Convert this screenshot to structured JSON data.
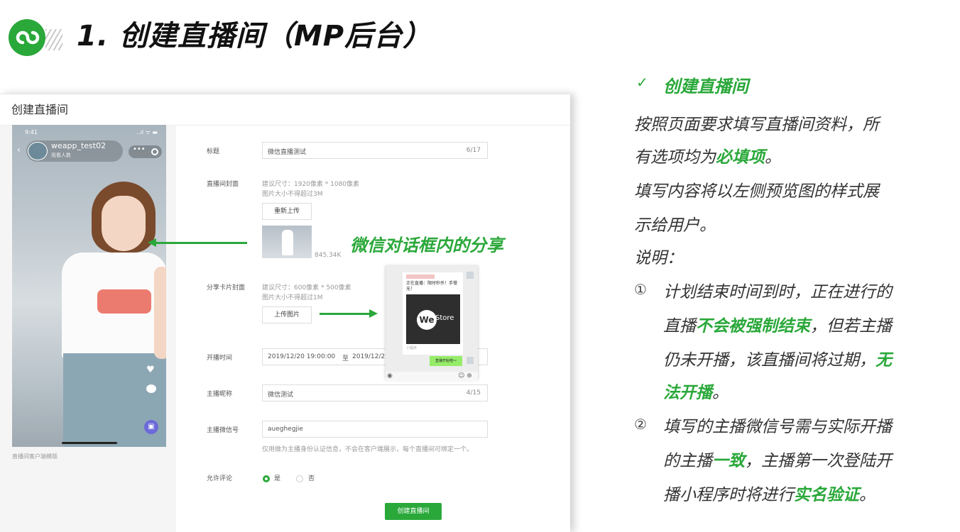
{
  "slide": {
    "title": "1. 创建直播间（MP后台）"
  },
  "colors": {
    "accent": "#2aa83a",
    "text": "#333333"
  },
  "screenshot": {
    "page_title": "创建直播间",
    "preview": {
      "time": "9:41",
      "signal": "..ıl ᯤ ▬",
      "room_name": "weapp_test02",
      "room_sub": "观看人数",
      "more_dots": "•••",
      "caption": "直播间客户端模版"
    },
    "form": {
      "title_label": "标题",
      "title_value": "微信直播测试",
      "title_count": "6/17",
      "cover_label": "直播间封面",
      "cover_hint_size": "建议尺寸：1920像素 * 1080像素",
      "cover_hint_limit": "图片大小不得超过3M",
      "reupload": "重新上传",
      "cover_file_size": "845.34K",
      "share_card_label": "分享卡片封面",
      "share_hint_size": "建议尺寸：600像素 * 500像素",
      "share_hint_limit": "图片大小不得超过1M",
      "upload_image": "上传图片",
      "time_label": "开播时间",
      "time_start": "2019/12/20 19:00:00",
      "time_sep": "至",
      "time_end": "2019/12/2",
      "anchor_nick_label": "主播昵称",
      "anchor_nick_value": "微信测试",
      "anchor_nick_count": "4/15",
      "anchor_wechat_label": "主播微信号",
      "anchor_wechat_value": "aueghegjie",
      "anchor_wechat_hint": "仅用做为主播身份认证信息，不会在客户端展示，每个直播间可绑定一个。",
      "allow_comment_label": "允许评论",
      "yes": "是",
      "no": "否",
      "submit": "创建直播间"
    },
    "share_annotation": "微信对话框内的分享",
    "chat_card": {
      "text": "正在直播：限时秒杀！手慢无！",
      "logo": "We",
      "store": "Store",
      "foot": "小程序",
      "bubble": "直播开始啦～",
      "voice_icon": "◉",
      "emoji_icons": "☺ ⊕"
    }
  },
  "explain": {
    "check": "✓",
    "heading": "创建直播间",
    "p1_line1": "按照页面要求填写直播间资料，所",
    "p1_line2_a": "有选项均为",
    "p1_line2_em": "必填项",
    "p1_line2_b": "。",
    "p2_line1": "填写内容将以左侧预览图的样式展",
    "p2_line2": "示给用户。",
    "note_label": "说明：",
    "n1_mark": "①",
    "n1_line1": "计划结束时间到时，正在进行的",
    "n1_line2_a": "直播",
    "n1_line2_em": "不会被强制结束",
    "n1_line2_b": "，但若主播",
    "n1_line3_a": "仍未开播，该直播间将过期，",
    "n1_line3_em": "无",
    "n1_line4_em": "法开播",
    "n1_line4_b": "。",
    "n2_mark": "②",
    "n2_line1": "填写的主播微信号需与实际开播",
    "n2_line2_a": "的主播",
    "n2_line2_em": "一致",
    "n2_line2_b": "，主播第一次登陆开",
    "n2_line3_a": "播小程序时将进行",
    "n2_line3_em": "实名验证",
    "n2_line3_b": "。"
  }
}
